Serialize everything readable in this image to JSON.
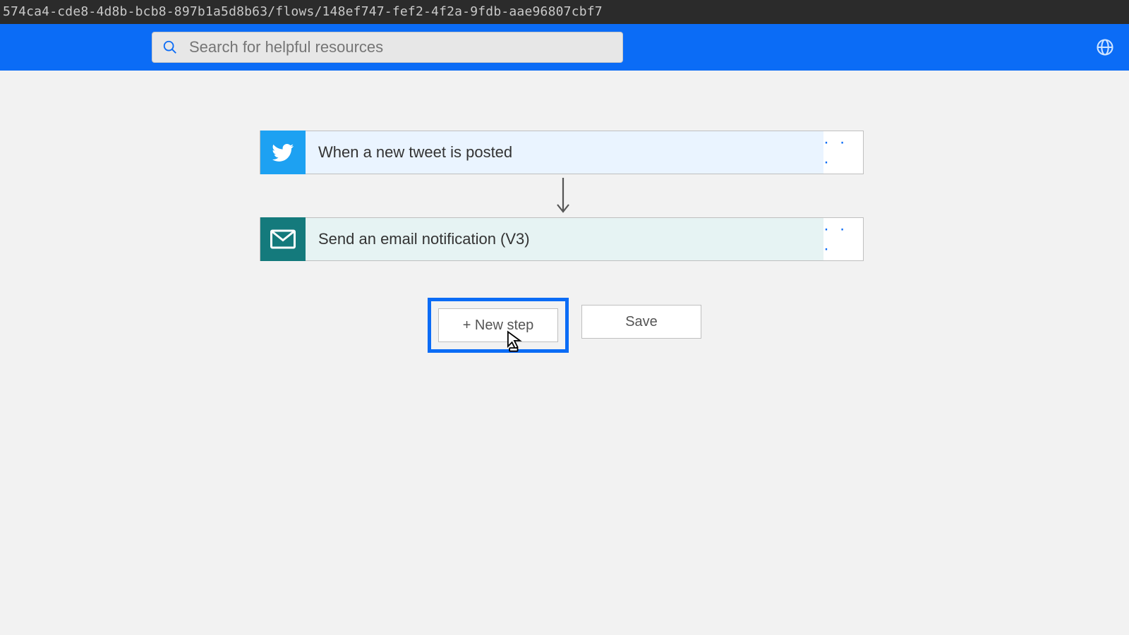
{
  "browser": {
    "url_fragment": "574ca4-cde8-4d8b-bcb8-897b1a5d8b63/flows/148ef747-fef2-4f2a-9fdb-aae96807cbf7"
  },
  "header": {
    "search_placeholder": "Search for helpful resources"
  },
  "flow": {
    "trigger": {
      "title": "When a new tweet is posted",
      "icon": "twitter-icon"
    },
    "action": {
      "title": "Send an email notification (V3)",
      "icon": "mail-icon"
    }
  },
  "buttons": {
    "new_step": "+ New step",
    "save": "Save"
  }
}
